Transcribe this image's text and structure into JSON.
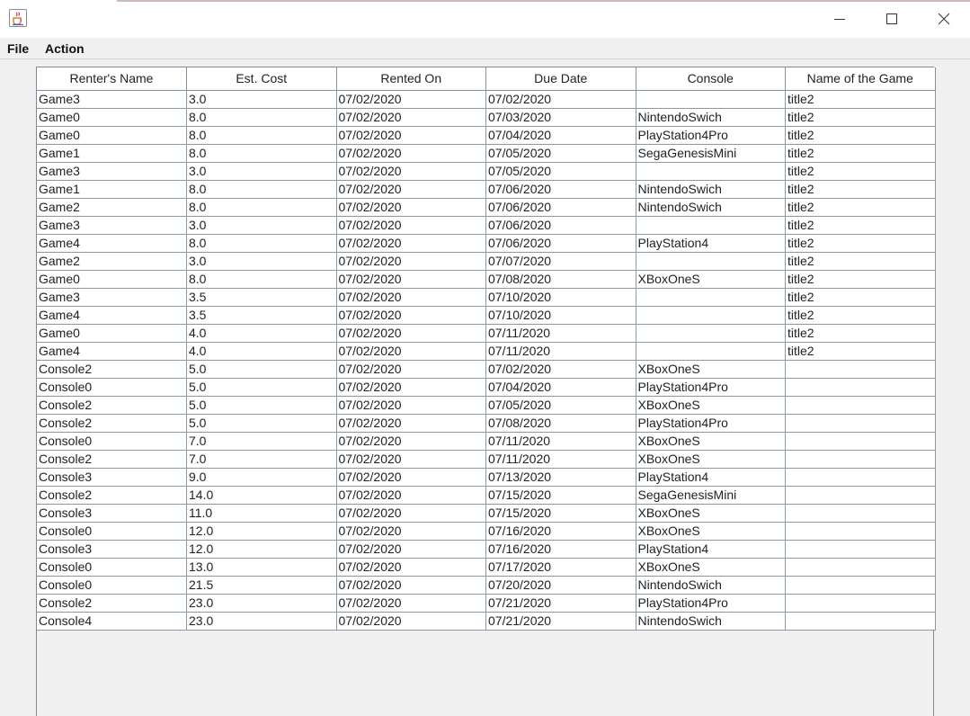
{
  "window": {
    "icon": "java-cup-icon",
    "controls": [
      "minimize-icon",
      "maximize-icon",
      "close-icon"
    ]
  },
  "menu": {
    "file_label": "File",
    "action_label": "Action"
  },
  "table": {
    "columns": [
      "Renter's Name",
      "Est. Cost",
      "Rented On",
      "Due Date",
      "Console",
      "Name of the Game"
    ],
    "rows": [
      [
        "Game3",
        "3.0",
        "07/02/2020",
        "07/02/2020",
        "",
        "title2"
      ],
      [
        "Game0",
        "8.0",
        "07/02/2020",
        "07/03/2020",
        "NintendoSwich",
        "title2"
      ],
      [
        "Game0",
        "8.0",
        "07/02/2020",
        "07/04/2020",
        "PlayStation4Pro",
        "title2"
      ],
      [
        "Game1",
        "8.0",
        "07/02/2020",
        "07/05/2020",
        "SegaGenesisMini",
        "title2"
      ],
      [
        "Game3",
        "3.0",
        "07/02/2020",
        "07/05/2020",
        "",
        "title2"
      ],
      [
        "Game1",
        "8.0",
        "07/02/2020",
        "07/06/2020",
        "NintendoSwich",
        "title2"
      ],
      [
        "Game2",
        "8.0",
        "07/02/2020",
        "07/06/2020",
        "NintendoSwich",
        "title2"
      ],
      [
        "Game3",
        "3.0",
        "07/02/2020",
        "07/06/2020",
        "",
        "title2"
      ],
      [
        "Game4",
        "8.0",
        "07/02/2020",
        "07/06/2020",
        "PlayStation4",
        "title2"
      ],
      [
        "Game2",
        "3.0",
        "07/02/2020",
        "07/07/2020",
        "",
        "title2"
      ],
      [
        "Game0",
        "8.0",
        "07/02/2020",
        "07/08/2020",
        "XBoxOneS",
        "title2"
      ],
      [
        "Game3",
        "3.5",
        "07/02/2020",
        "07/10/2020",
        "",
        "title2"
      ],
      [
        "Game4",
        "3.5",
        "07/02/2020",
        "07/10/2020",
        "",
        "title2"
      ],
      [
        "Game0",
        "4.0",
        "07/02/2020",
        "07/11/2020",
        "",
        "title2"
      ],
      [
        "Game4",
        "4.0",
        "07/02/2020",
        "07/11/2020",
        "",
        "title2"
      ],
      [
        "Console2",
        "5.0",
        "07/02/2020",
        "07/02/2020",
        "XBoxOneS",
        ""
      ],
      [
        "Console0",
        "5.0",
        "07/02/2020",
        "07/04/2020",
        "PlayStation4Pro",
        ""
      ],
      [
        "Console2",
        "5.0",
        "07/02/2020",
        "07/05/2020",
        "XBoxOneS",
        ""
      ],
      [
        "Console2",
        "5.0",
        "07/02/2020",
        "07/08/2020",
        "PlayStation4Pro",
        ""
      ],
      [
        "Console0",
        "7.0",
        "07/02/2020",
        "07/11/2020",
        "XBoxOneS",
        ""
      ],
      [
        "Console2",
        "7.0",
        "07/02/2020",
        "07/11/2020",
        "XBoxOneS",
        ""
      ],
      [
        "Console3",
        "9.0",
        "07/02/2020",
        "07/13/2020",
        "PlayStation4",
        ""
      ],
      [
        "Console2",
        "14.0",
        "07/02/2020",
        "07/15/2020",
        "SegaGenesisMini",
        ""
      ],
      [
        "Console3",
        "11.0",
        "07/02/2020",
        "07/15/2020",
        "XBoxOneS",
        ""
      ],
      [
        "Console0",
        "12.0",
        "07/02/2020",
        "07/16/2020",
        "XBoxOneS",
        ""
      ],
      [
        "Console3",
        "12.0",
        "07/02/2020",
        "07/16/2020",
        "PlayStation4",
        ""
      ],
      [
        "Console0",
        "13.0",
        "07/02/2020",
        "07/17/2020",
        "XBoxOneS",
        ""
      ],
      [
        "Console0",
        "21.5",
        "07/02/2020",
        "07/20/2020",
        "NintendoSwich",
        ""
      ],
      [
        "Console2",
        "23.0",
        "07/02/2020",
        "07/21/2020",
        "PlayStation4Pro",
        ""
      ],
      [
        "Console4",
        "23.0",
        "07/02/2020",
        "07/21/2020",
        "NintendoSwich",
        ""
      ]
    ]
  }
}
